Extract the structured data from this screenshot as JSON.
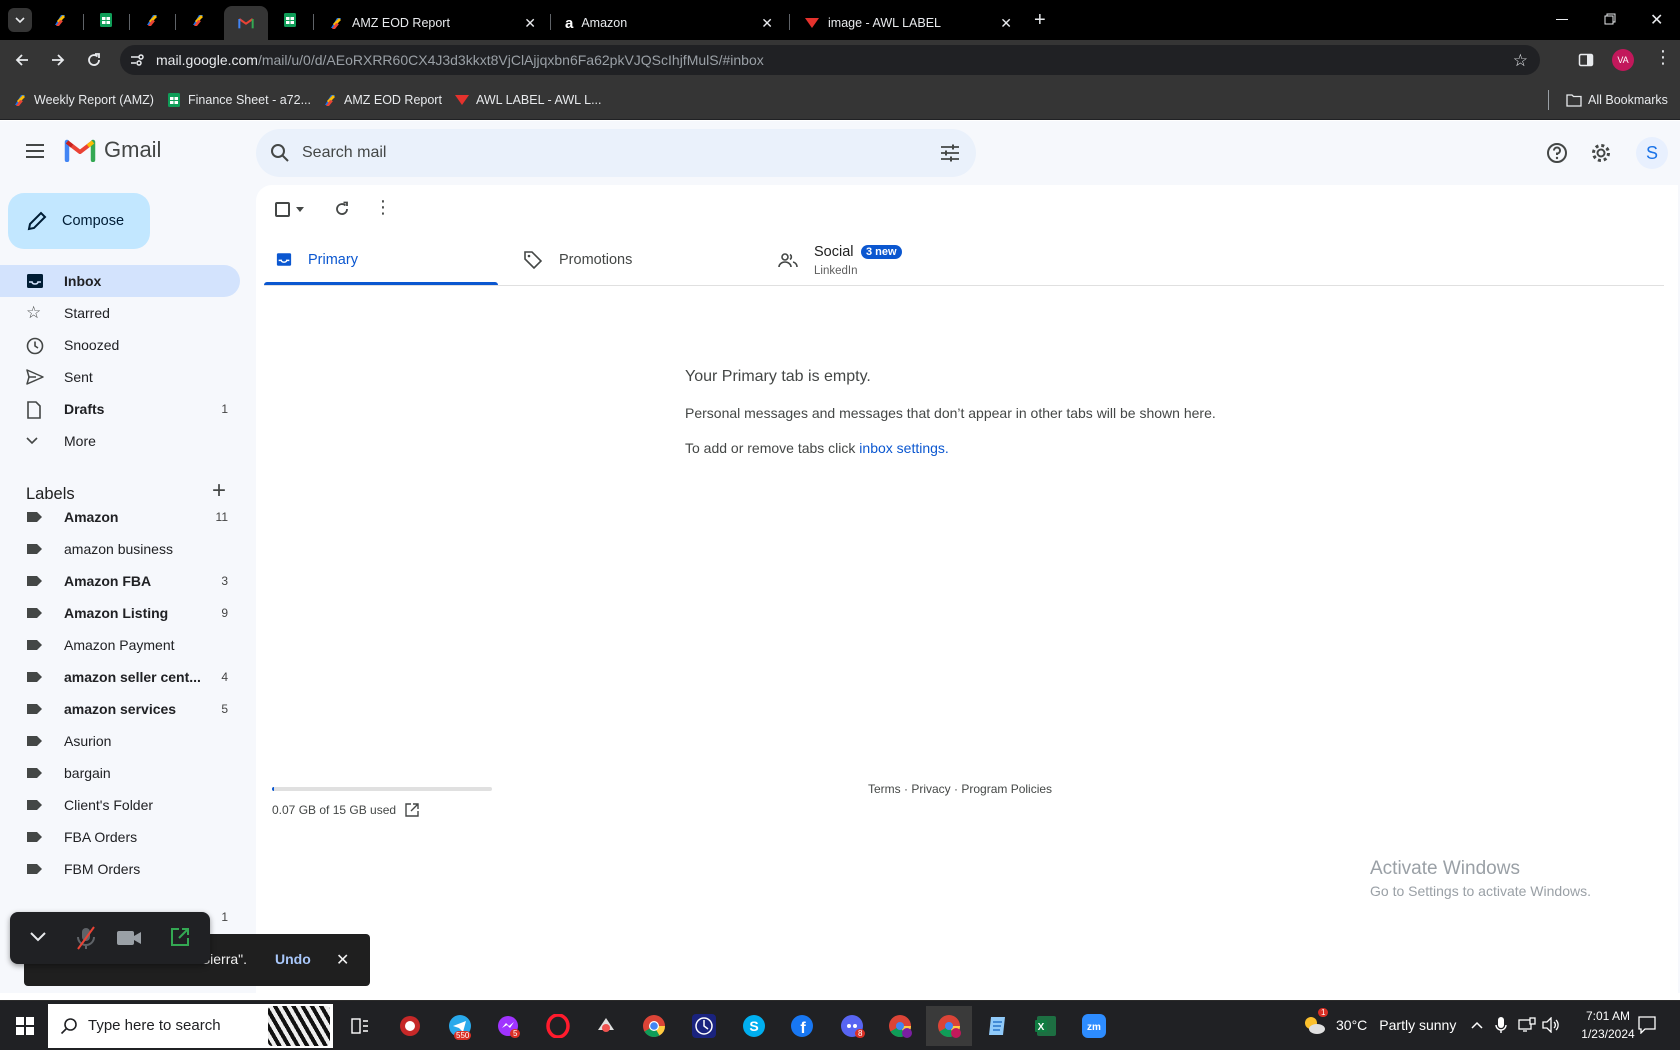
{
  "browser": {
    "tabs": [
      {
        "title": "AMZ EOD Report"
      },
      {
        "title": "Amazon"
      },
      {
        "title": "image - AWL LABEL"
      }
    ],
    "url_host": "mail.google.com",
    "url_path": "/mail/u/0/d/AEoRXRR60CX4J3d3kkxt8VjClAjjqxbn6Fa62pkVJQScIhjfMulS/#inbox",
    "profile_initials": "VA",
    "bookmarks": [
      "Weekly Report (AMZ)",
      "Finance Sheet - a72...",
      "AMZ EOD Report",
      "AWL LABEL - AWL L..."
    ],
    "all_bookmarks": "All Bookmarks"
  },
  "gmail": {
    "logo_text": "Gmail",
    "search_placeholder": "Search mail",
    "compose": "Compose",
    "account_initial": "S",
    "nav": [
      {
        "label": "Inbox",
        "count": ""
      },
      {
        "label": "Starred",
        "count": ""
      },
      {
        "label": "Snoozed",
        "count": ""
      },
      {
        "label": "Sent",
        "count": ""
      },
      {
        "label": "Drafts",
        "count": "1"
      },
      {
        "label": "More",
        "count": ""
      }
    ],
    "labels_title": "Labels",
    "labels": [
      {
        "label": "Amazon",
        "count": "11",
        "bold": true
      },
      {
        "label": "amazon business",
        "count": "",
        "bold": false
      },
      {
        "label": "Amazon FBA",
        "count": "3",
        "bold": true
      },
      {
        "label": "Amazon Listing",
        "count": "9",
        "bold": true
      },
      {
        "label": "Amazon Payment",
        "count": "",
        "bold": false
      },
      {
        "label": "amazon seller cent...",
        "count": "4",
        "bold": true
      },
      {
        "label": "amazon services",
        "count": "5",
        "bold": true
      },
      {
        "label": "Asurion",
        "count": "",
        "bold": false
      },
      {
        "label": "bargain",
        "count": "",
        "bold": false
      },
      {
        "label": "Client's Folder",
        "count": "",
        "bold": false
      },
      {
        "label": "FBA Orders",
        "count": "",
        "bold": false
      },
      {
        "label": "FBM Orders",
        "count": "",
        "bold": false
      }
    ],
    "label_partial_count": "1",
    "tabs": {
      "primary": "Primary",
      "promotions": "Promotions",
      "social": "Social",
      "social_badge": "3 new",
      "social_sub": "LinkedIn"
    },
    "empty": {
      "title": "Your Primary tab is empty.",
      "line1": "Personal messages and messages that don’t appear in other tabs will be shown here.",
      "line2_prefix": "To add or remove tabs click ",
      "line2_link": "inbox settings."
    },
    "storage": {
      "text": "0.07 GB of 15 GB used",
      "fraction": 0.005
    },
    "footer": {
      "terms": "Terms",
      "privacy": "Privacy",
      "policies": "Program Policies",
      "sep": " · "
    },
    "snackbar": {
      "text": "Conversation moved to \"Sierra\".",
      "undo": "Undo"
    },
    "watermark": {
      "title": "Activate Windows",
      "sub": "Go to Settings to activate Windows."
    }
  },
  "taskbar": {
    "search_placeholder": "Type here to search",
    "weather_temp": "30°C",
    "weather_text": "Partly sunny",
    "time": "7:01 AM",
    "date": "1/23/2024",
    "badge_telegram": "550",
    "badge_messenger": "5",
    "badge_discord": "8",
    "weather_alert": "1"
  }
}
